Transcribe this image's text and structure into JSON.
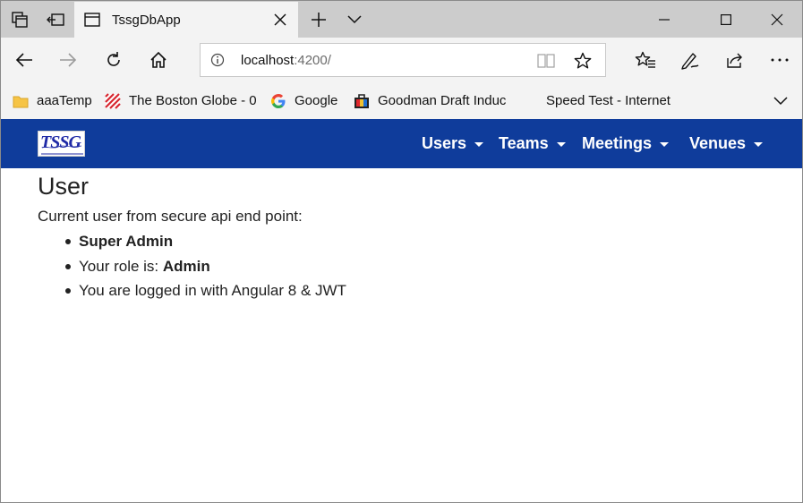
{
  "browser": {
    "tab": {
      "title": "TssgDbApp"
    },
    "address": {
      "host": "localhost",
      "port_path": ":4200/"
    },
    "favorites": [
      {
        "label": "aaaTemp",
        "icon": "folder-icon"
      },
      {
        "label": "The Boston Globe - 0",
        "icon": "boston-globe-icon"
      },
      {
        "label": "Google",
        "icon": "google-icon"
      },
      {
        "label": "Goodman Draft Induc",
        "icon": "goodman-icon"
      },
      {
        "label": "Speed Test - Internet",
        "icon": "none"
      }
    ]
  },
  "app": {
    "brand": "TSSG",
    "menu": [
      {
        "label": "Users"
      },
      {
        "label": "Teams"
      },
      {
        "label": "Meetings"
      },
      {
        "label": "Venues"
      }
    ],
    "colors": {
      "navbar": "#0f3c9b",
      "tabbar": "#cccccc",
      "toolbar": "#f3f3f3"
    }
  },
  "page": {
    "title": "User",
    "intro": "Current user from secure api end point:",
    "user_name": "Super Admin",
    "role_prefix": "Your role is: ",
    "role": "Admin",
    "login_note": "You are logged in with Angular 8 & JWT"
  }
}
